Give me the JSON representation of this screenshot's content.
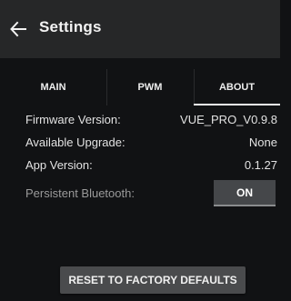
{
  "appbar": {
    "title": "Settings",
    "back_icon": "arrow-left-icon"
  },
  "tabs": [
    {
      "label": "MAIN"
    },
    {
      "label": "PWM"
    },
    {
      "label": "ABOUT",
      "selected": true
    }
  ],
  "info_rows": [
    {
      "label": "Firmware Version:",
      "value": "VUE_PRO_V0.9.8"
    },
    {
      "label": "Available Upgrade:",
      "value": "None"
    },
    {
      "label": "App Version:",
      "value": "0.1.27"
    }
  ],
  "persistent_bluetooth": {
    "label": "Persistent Bluetooth:",
    "toggle_label": "ON"
  },
  "reset_button": {
    "label": "RESET TO FACTORY DEFAULTS"
  },
  "colors": {
    "background": "#111214",
    "appbar": "#262728",
    "text": "#e2e2e2",
    "muted_text": "#9a9a9a",
    "toggle_bg": "#45474a",
    "button_bg": "#4a4b4d"
  }
}
